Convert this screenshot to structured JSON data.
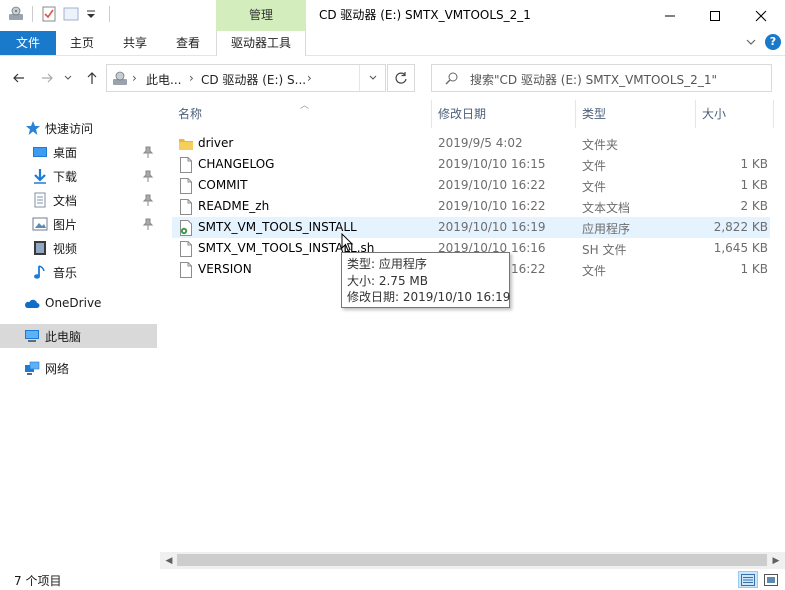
{
  "window": {
    "title": "CD 驱动器 (E:) SMTX_VMTOOLS_2_1",
    "context_tab_group": "管理"
  },
  "ribbon": {
    "tabs": [
      "文件",
      "主页",
      "共享",
      "查看"
    ],
    "context_tab": "驱动器工具",
    "help": "?"
  },
  "address": {
    "segments": [
      "此电...",
      "CD 驱动器 (E:) S..."
    ],
    "search_placeholder": "搜索\"CD 驱动器 (E:) SMTX_VMTOOLS_2_1\""
  },
  "nav": {
    "quick_access": "快速访问",
    "quick_items": [
      "桌面",
      "下载",
      "文档",
      "图片",
      "视频",
      "音乐"
    ],
    "onedrive": "OneDrive",
    "this_pc": "此电脑",
    "network": "网络"
  },
  "columns": {
    "name": "名称",
    "date": "修改日期",
    "type": "类型",
    "size": "大小"
  },
  "files": [
    {
      "name": "driver",
      "date": "2019/9/5 4:02",
      "type": "文件夹",
      "size": "",
      "icon": "folder-icon"
    },
    {
      "name": "CHANGELOG",
      "date": "2019/10/10 16:15",
      "type": "文件",
      "size": "1 KB",
      "icon": "file-icon"
    },
    {
      "name": "COMMIT",
      "date": "2019/10/10 16:22",
      "type": "文件",
      "size": "1 KB",
      "icon": "file-icon"
    },
    {
      "name": "README_zh",
      "date": "2019/10/10 16:22",
      "type": "文本文档",
      "size": "2 KB",
      "icon": "file-icon"
    },
    {
      "name": "SMTX_VM_TOOLS_INSTALL",
      "date": "2019/10/10 16:19",
      "type": "应用程序",
      "size": "2,822 KB",
      "icon": "application-icon"
    },
    {
      "name": "SMTX_VM_TOOLS_INSTALL.sh",
      "date": "2019/10/10 16:16",
      "type": "SH 文件",
      "size": "1,645 KB",
      "icon": "file-icon"
    },
    {
      "name": "VERSION",
      "date": "2019/10/10 16:22",
      "type": "文件",
      "size": "1 KB",
      "icon": "file-icon"
    }
  ],
  "tooltip": {
    "line1": "类型: 应用程序",
    "line2": "大小: 2.75 MB",
    "line3": "修改日期: 2019/10/10 16:19"
  },
  "status": {
    "count": "7 个项目"
  },
  "colors": {
    "accent": "#1979ca",
    "context_tab": "#d4edbc",
    "hover_row": "#e5f3ff",
    "folder": "#e8b93c"
  }
}
